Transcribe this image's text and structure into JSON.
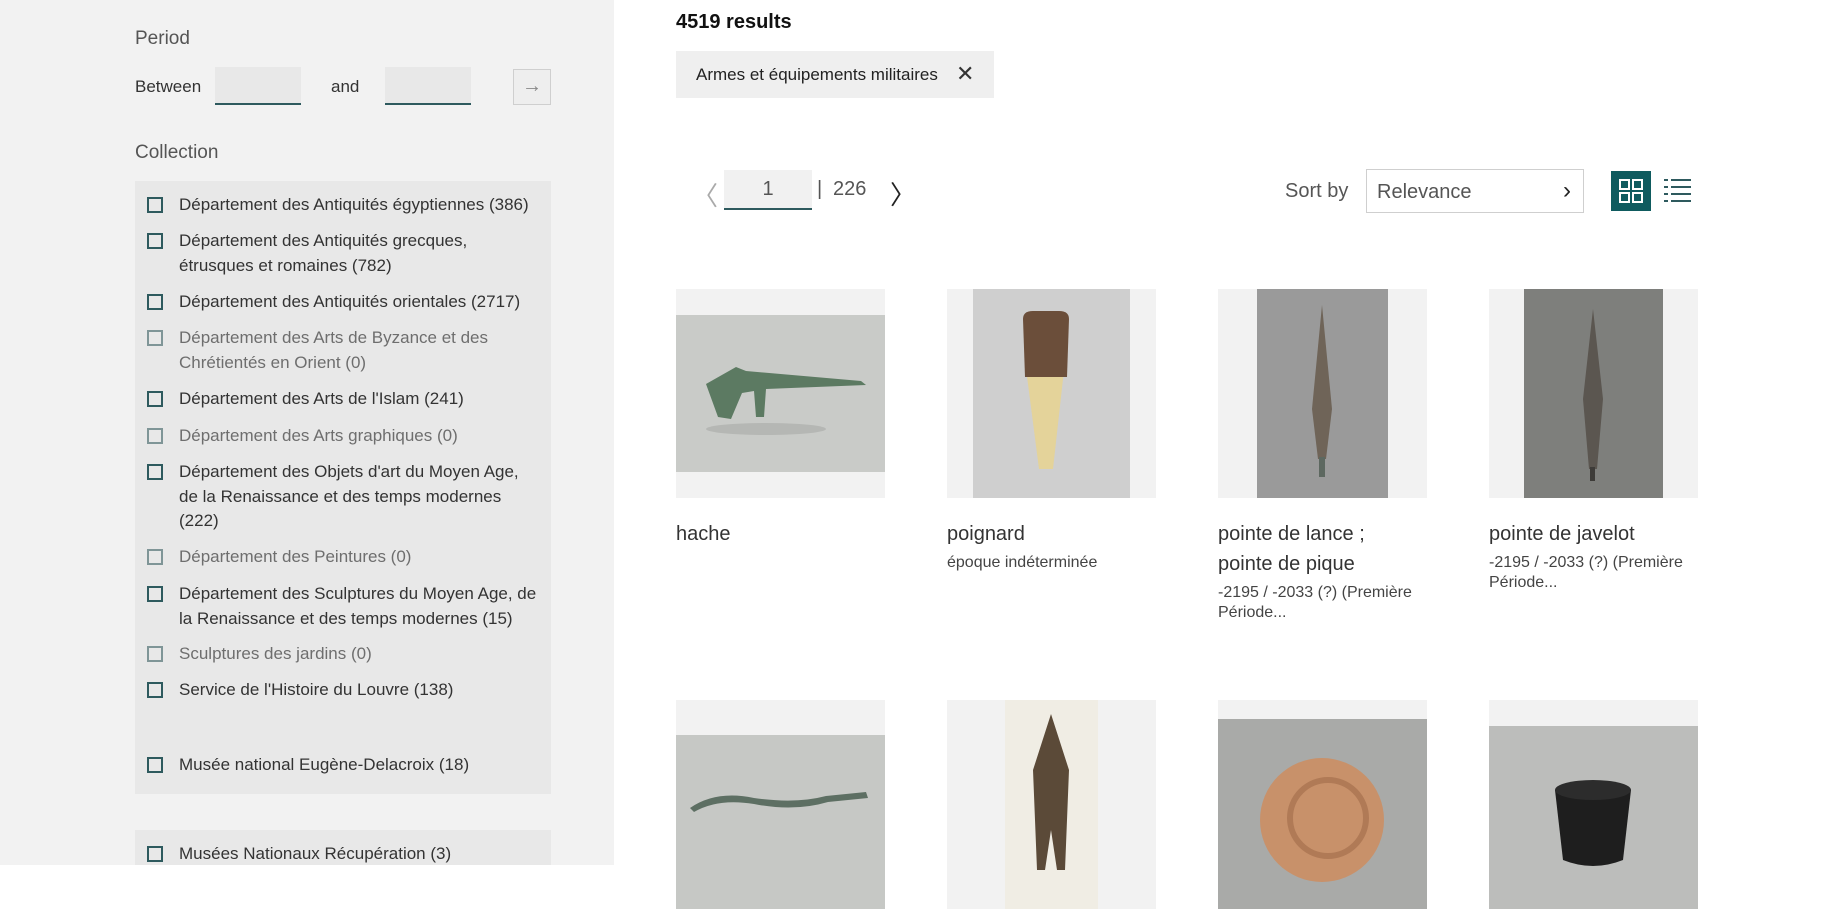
{
  "filters": {
    "period_title": "Period",
    "between_label": "Between",
    "and_label": "and",
    "from_value": "",
    "to_value": "",
    "go_icon": "arrow-right-icon",
    "collection_title": "Collection",
    "collections": [
      {
        "label": "Département des Antiquités égyptiennes (386)",
        "enabled": true
      },
      {
        "label": "Département des Antiquités grecques, étrusques et romaines (782)",
        "enabled": true
      },
      {
        "label": "Département des Antiquités orientales (2717)",
        "enabled": true
      },
      {
        "label": "Département des Arts de Byzance et des Chrétientés en Orient (0)",
        "enabled": false
      },
      {
        "label": "Département des Arts de l'Islam (241)",
        "enabled": true
      },
      {
        "label": "Département des Arts graphiques (0)",
        "enabled": false
      },
      {
        "label": "Département des Objets d'art du Moyen Age, de la Renaissance et des temps modernes (222)",
        "enabled": true
      },
      {
        "label": "Département des Peintures (0)",
        "enabled": false
      },
      {
        "label": "Département des Sculptures du Moyen Age, de la Renaissance et des temps modernes (15)",
        "enabled": true
      },
      {
        "label": "Sculptures des jardins (0)",
        "enabled": false
      },
      {
        "label": "Service de l'Histoire du Louvre (138)",
        "enabled": true
      },
      {
        "label": "Musée national Eugène-Delacroix (18)",
        "enabled": true
      }
    ],
    "collections_extra": [
      {
        "label": "Musées Nationaux Récupération (3)",
        "enabled": true
      }
    ]
  },
  "results": {
    "count_label": "4519 results",
    "active_filter": "Armes et équipements militaires",
    "pagination": {
      "current": "1",
      "separator": "|",
      "total": "226"
    },
    "sort": {
      "label": "Sort by",
      "value": "Relevance"
    },
    "view_mode": "grid",
    "items": [
      {
        "title": "hache",
        "date": ""
      },
      {
        "title": "poignard",
        "date": "époque indéterminée"
      },
      {
        "title": "pointe de lance ; pointe de pique",
        "date": "-2195 / -2033 (?) (Première Période..."
      },
      {
        "title": "pointe de javelot",
        "date": "-2195 / -2033 (?) (Première Période..."
      },
      {
        "title": "",
        "date": ""
      },
      {
        "title": "",
        "date": ""
      },
      {
        "title": "",
        "date": ""
      },
      {
        "title": "",
        "date": ""
      }
    ]
  },
  "colors": {
    "accent": "#0f5b5f",
    "sidebar_bg": "#f2f2f2",
    "filter_box_bg": "#e8e8e8"
  }
}
